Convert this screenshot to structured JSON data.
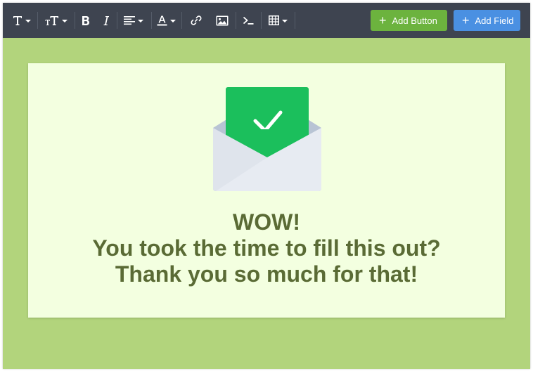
{
  "toolbar": {
    "items": [
      {
        "name": "text-style-dropdown",
        "icon": "text-icon",
        "has_caret": true
      },
      {
        "name": "font-size-dropdown",
        "icon": "font-size-icon",
        "has_caret": true
      },
      {
        "name": "bold-button",
        "icon": "bold-icon",
        "has_caret": false
      },
      {
        "name": "italic-button",
        "icon": "italic-icon",
        "has_caret": false
      },
      {
        "name": "align-dropdown",
        "icon": "align-left-icon",
        "has_caret": true
      },
      {
        "name": "text-color-dropdown",
        "icon": "text-color-icon",
        "has_caret": true
      },
      {
        "name": "link-button",
        "icon": "link-icon",
        "has_caret": false
      },
      {
        "name": "image-button",
        "icon": "image-icon",
        "has_caret": false
      },
      {
        "name": "code-button",
        "icon": "terminal-icon",
        "has_caret": false
      },
      {
        "name": "table-dropdown",
        "icon": "table-icon",
        "has_caret": true
      }
    ],
    "add_button_label": "Add Button",
    "add_field_label": "Add Field",
    "add_button_color": "#6cb33e",
    "add_field_color": "#4a90e2",
    "background_color": "#3e4450"
  },
  "canvas": {
    "background_color": "#b2d47c",
    "card_background_color": "#f3ffe0",
    "illustration_icon": "envelope-check-icon",
    "message": {
      "line1": "WOW!",
      "line2": "You took the time to fill this out?",
      "line3": "Thank you so much for that!",
      "color": "#5a6b35"
    }
  }
}
